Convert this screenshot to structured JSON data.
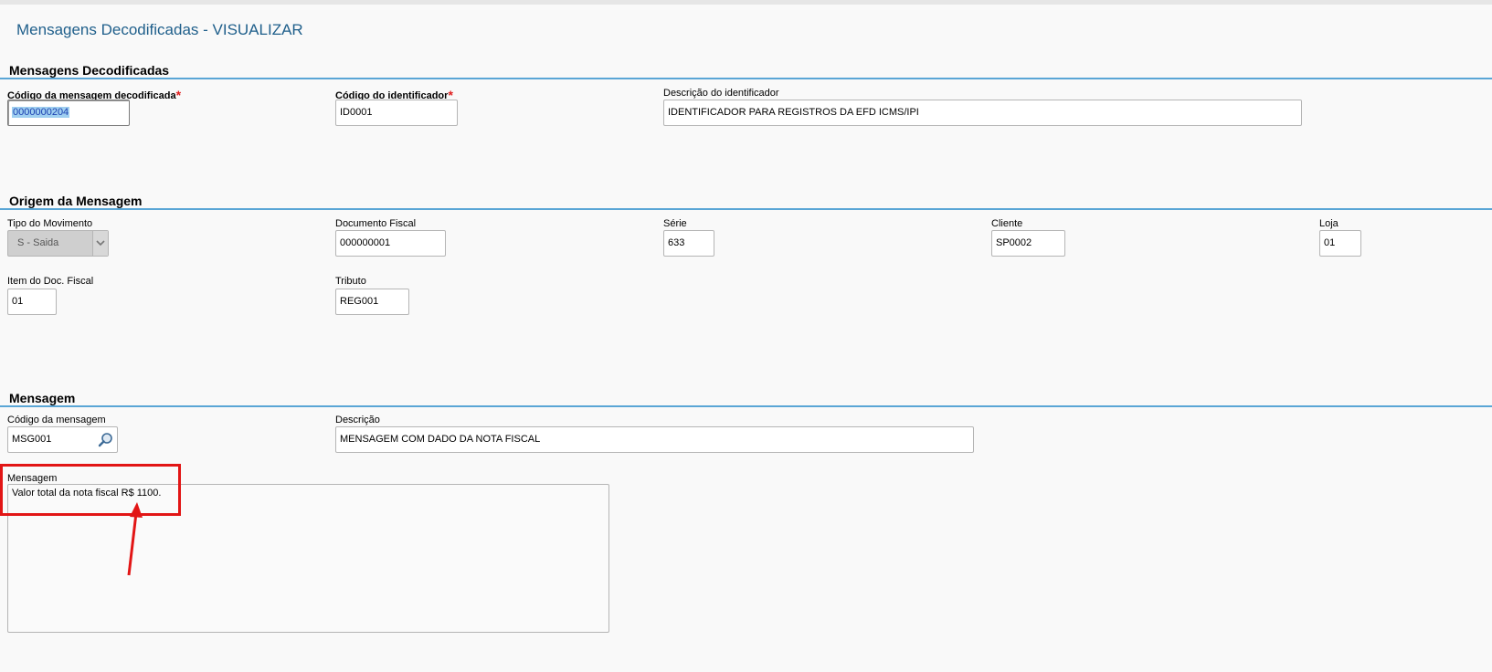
{
  "page": {
    "title": "Mensagens Decodificadas - VISUALIZAR"
  },
  "sections": {
    "mensagens_decodificadas": {
      "title": "Mensagens Decodificadas",
      "codigo_mensagem_label": "Código da mensagem decodificada",
      "codigo_mensagem_value": "0000000204",
      "codigo_identificador_label": "Código do identificador",
      "codigo_identificador_value": "ID0001",
      "descricao_identificador_label": "Descrição do identificador",
      "descricao_identificador_value": "IDENTIFICADOR PARA REGISTROS DA EFD ICMS/IPI"
    },
    "origem": {
      "title": "Origem da Mensagem",
      "tipo_movimento_label": "Tipo do Movimento",
      "tipo_movimento_value": "S - Saida",
      "documento_fiscal_label": "Documento Fiscal",
      "documento_fiscal_value": "000000001",
      "serie_label": "Série",
      "serie_value": "633",
      "cliente_label": "Cliente",
      "cliente_value": "SP0002",
      "loja_label": "Loja",
      "loja_value": "01",
      "item_label": "Item do Doc. Fiscal",
      "item_value": "01",
      "tributo_label": "Tributo",
      "tributo_value": "REG001"
    },
    "mensagem": {
      "title": "Mensagem",
      "codigo_label": "Código da mensagem",
      "codigo_value": "MSG001",
      "descricao_label": "Descrição",
      "descricao_value": "MENSAGEM COM DADO DA NOTA FISCAL",
      "mensagem_label": "Mensagem",
      "mensagem_value": "Valor total da nota fiscal R$ 1100."
    }
  },
  "required_marker": "*",
  "colors": {
    "title": "#1f5f8b",
    "section_line": "#5aa6d6",
    "required": "#e02020",
    "highlight": "#e21515"
  },
  "icons": {
    "lookup": "magnifier-icon",
    "dropdown": "chevron-down-icon"
  }
}
